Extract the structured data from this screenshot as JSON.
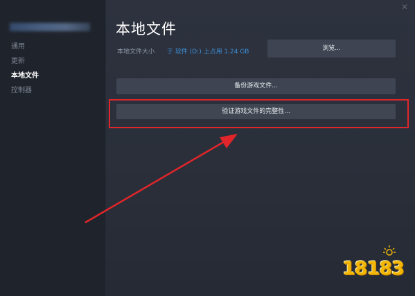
{
  "sidebar": {
    "items": [
      {
        "label": "通用",
        "active": false
      },
      {
        "label": "更新",
        "active": false
      },
      {
        "label": "本地文件",
        "active": true
      },
      {
        "label": "控制器",
        "active": false
      }
    ]
  },
  "main": {
    "title": "本地文件",
    "size_label": "本地文件大小",
    "size_value": "于 软件 (D:) 上占用 1.24 GB",
    "browse_label": "浏览...",
    "backup_label": "备份游戏文件...",
    "verify_label": "验证游戏文件的完整性..."
  },
  "watermark": {
    "text": "18183"
  },
  "colors": {
    "highlight": "#e0262a",
    "link": "#3e8fd6",
    "watermark": "#f2b705"
  },
  "icons": {
    "close": "close-icon",
    "arrow": "red-arrow-annotation"
  }
}
